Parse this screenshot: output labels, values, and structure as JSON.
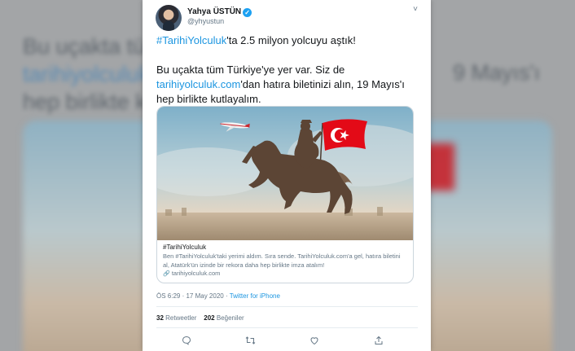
{
  "background": {
    "lines": [
      "Bu uçakta tüm",
      "tarihiyolculuk",
      "hep birlikte k"
    ],
    "right_fragment": "9 Mayıs'ı"
  },
  "tweet": {
    "author_name": "Yahya ÜSTÜN",
    "verified_icon": "✓",
    "handle": "@yhyustun",
    "menu_icon": "˅",
    "hashtag": "#TarihiYolculuk",
    "line1_rest": "'ta 2.5 milyon yolcuyu aştık!",
    "line2_pre": "Bu uçakta tüm Türkiye'ye yer var. Siz de",
    "line2_link": "tarihiyolculuk.com",
    "line2_post": "'dan hatıra biletinizi alın, 19 Mayıs'ı hep birlikte kutlayalım."
  },
  "card": {
    "title": "#TarihiYolculuk",
    "description": "Ben #TarihiYolculuk'taki yerimi aldım. Sıra sende. TarihiYolculuk.com'a gel, hatıra biletini al, Atatürk'ün izinde bir rekora daha hep birlikte imza atalım!",
    "domain": "tarihiyolculuk.com",
    "link_icon": "🔗"
  },
  "meta": {
    "timestamp": "ÖS 6:29 · 17 May 2020 ·",
    "source": "Twitter for iPhone"
  },
  "stats": {
    "retweets_count": "32",
    "retweets_label": "Retweetler",
    "likes_count": "202",
    "likes_label": "Beğeniler"
  },
  "colors": {
    "link": "#1b95e0",
    "verified": "#1da1f2",
    "flag_red": "#e30a17"
  }
}
